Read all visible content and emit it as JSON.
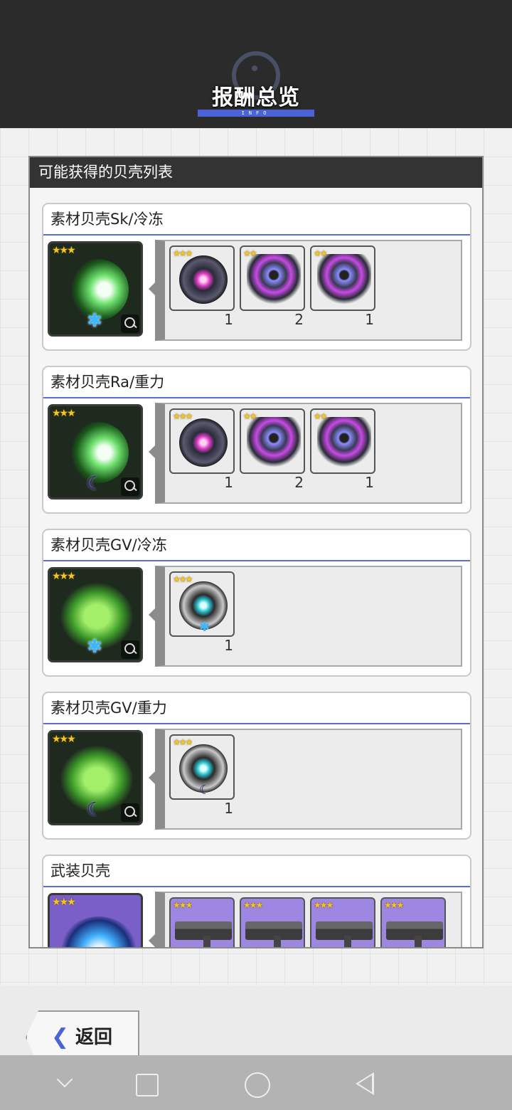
{
  "header": {
    "title": "报酬总览",
    "subtitle": "INFO",
    "accent": "#4c63d8"
  },
  "panel": {
    "title": "可能获得的贝壳列表"
  },
  "sections": [
    {
      "title": "素材贝壳Sk/冷冻",
      "icon": "green-shell-freeze-icon",
      "drops": [
        {
          "icon": "pink-eye-orb-icon",
          "qty": "1"
        },
        {
          "icon": "purple-gear-part-icon",
          "qty": "2"
        },
        {
          "icon": "purple-gear-part-icon",
          "qty": "1"
        }
      ]
    },
    {
      "title": "素材贝壳Ra/重力",
      "icon": "green-shell-gravity-icon",
      "drops": [
        {
          "icon": "pink-eye-orb-icon",
          "qty": "1"
        },
        {
          "icon": "purple-gear-part-icon",
          "qty": "2"
        },
        {
          "icon": "purple-gear-part-icon",
          "qty": "1"
        }
      ]
    },
    {
      "title": "素材贝壳GV/冷冻",
      "icon": "spiky-shell-freeze-icon",
      "drops": [
        {
          "icon": "teal-eye-orb-freeze-icon",
          "qty": "1"
        }
      ]
    },
    {
      "title": "素材贝壳GV/重力",
      "icon": "spiky-shell-gravity-icon",
      "drops": [
        {
          "icon": "teal-eye-orb-gravity-icon",
          "qty": "1"
        }
      ]
    },
    {
      "title": "武装贝壳",
      "icon": "blue-energy-shell-icon",
      "drops": [
        {
          "icon": "rifle-weapon-icon"
        },
        {
          "icon": "rifle-weapon-icon"
        },
        {
          "icon": "heavy-cannon-icon"
        },
        {
          "icon": "heavy-cannon-icon"
        }
      ]
    }
  ],
  "back_button": {
    "label": "返回"
  }
}
